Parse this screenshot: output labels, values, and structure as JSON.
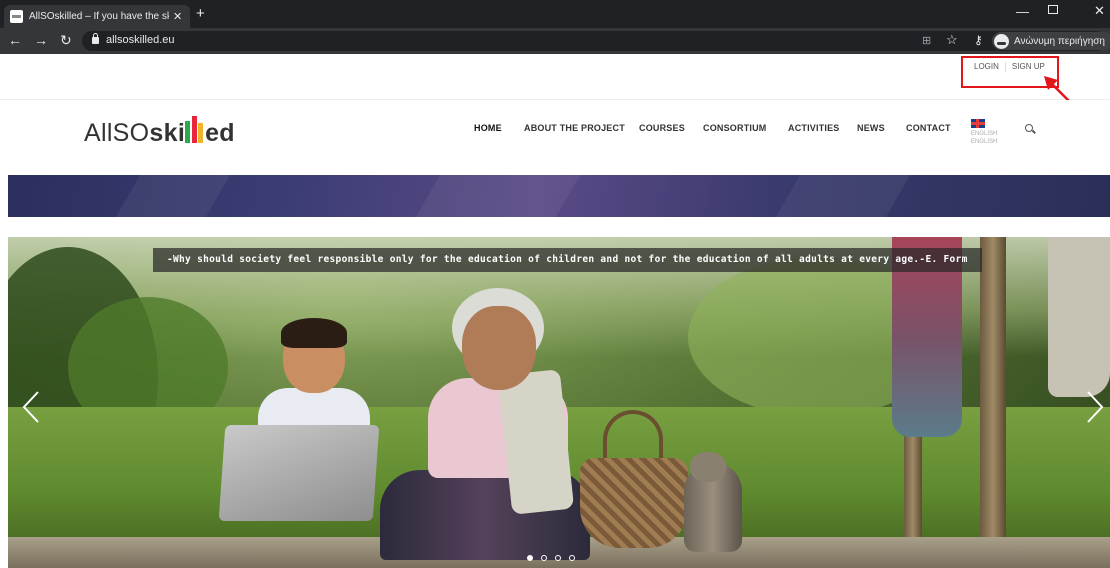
{
  "browser": {
    "tab_title": "AllSOskilled – If you have the skil",
    "tab_close": "✕",
    "new_tab": "+",
    "url": "allsoskilled.eu",
    "profile_label": "Ανώνυμη περιήγηση"
  },
  "top_links": {
    "login": "LOGIN",
    "signup": "SIGN UP"
  },
  "annotation": {
    "highlight_color": "#e2161b"
  },
  "logo": {
    "part1": "AllSO",
    "part2": "ski",
    "part3": "ed",
    "colors": [
      "#2da84a",
      "#e8263b",
      "#f0b429"
    ]
  },
  "nav": {
    "items": [
      "HOME",
      "ABOUT THE PROJECT",
      "COURSES",
      "CONSORTIUM",
      "ACTIVITIES",
      "NEWS",
      "CONTACT"
    ],
    "active": "HOME",
    "language_line1": "ENGLISH",
    "language_line2": "ENGLISH"
  },
  "slider": {
    "quote": "-Why should society feel responsible only for the education of children and not for the education of all adults at every age.-E. Form",
    "dot_count": 4,
    "active_dot": 0
  },
  "icons": [
    "tab-favicon",
    "back-icon",
    "forward-icon",
    "reload-icon",
    "lock-icon",
    "translate-icon",
    "star-icon",
    "key-icon",
    "incognito-icon",
    "flag-uk-icon",
    "search-icon",
    "chevron-left-icon",
    "chevron-right-icon"
  ]
}
